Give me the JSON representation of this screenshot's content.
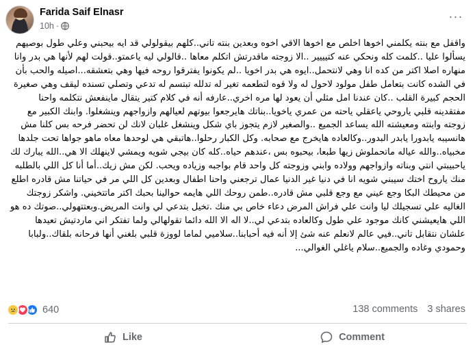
{
  "post": {
    "author": "Farida Saif Elnasr",
    "time": "10h",
    "separator": "·",
    "privacy_icon": "globe-icon",
    "more_label": "···",
    "text": "واقفل مع بنته يكلمني اخوها اخلص مع اخوها الاقي اخوه وبعدين بنته تاني..كلهم بيقولولي قد ايه بيحبني وعلي طول بوصيهم يسألوا عليا ..كلمت كله ونحكي عنه كتيييير ..الا زوجته ماقدرتش اتكلم معاها ..قالولي ليه ياعمتو..قولت لهم لأنها هي بدر وانا منهاره اصلا اكتر من كده انا وهي لانتحمل..ايوه هي بدر اخويا ..لم يكونوا يفترقوا روحه فيها وهي بتعشقه...اصيله والحب بأن في الشده كانت بتعامل طفل مولود لاحول له ولا قوه لتطعمه تغير له تدلله تبتسم له تدعي وتصلي تسنده ليقف وهي صغيرة الحجم كبيرة القلب ..كان عندنا امل مثلي أن يعود لها مره اخري..عارفه أنه في كلام كتير يتقال ماينفعش نتكلمه واحنا مفتقدينه قلبي ياروحي ياعقلي ياحته من عمري ياخويا..بناتك هايرجعوا بيوتهم لعيالهم وازواجهم وينشغلوا. وابنك الكبير مع زوجته وابنته ومعيشته الله يساعد الجميع ..والصغير لازم يتجوز باي شكل وينشغل غلبان لانك لن تحضر فرحه بس كلنا مش هانسيبه يابدورا يابدر البدور..وكالعاده هايخرج مع صحابه. وكل الكبار رحلوا..هاتبقي هي لوحدها معاه ماهو جواها تحت جلدها مخبياه..والله عياله ماتحملوش زيها طبعا، بيحبوه بس ،عندهم حياه..كله كان بيجي شويه ويمشي لاينهلك الا هي..الله يبارك لك ياحبيبتي انتي وبناته وازواجهم وولاده وابني وزوجته كل واحد قام بواجبه وزياده ويحب. لكن مش زيك..أما أنا كل اللي بالطلبه منك ياروح اختك سيبني شويه انا في دنيا غير الدنيا عمال ترجعني واحنا اطفال وبعدين كل اللي مر في حياتنا مش قادره اطلع من محيطك البكا وجع عيني مع وجع قلبي مش قادره..طمن روحك اللي هايمه حوالينا بحبك اكتر ماتتخيني. واشكر زوجتك الغاليه علي تسجيلك ليا وانت علي فراش المرض دعاء خاص بي منك .تخيل بتدعي لي وانت المريض.وبعتتهولي..صوتك ده هو اللي هايعيشني كانك موجود علي طول وكالعاده بتدعي لي..لا اله الا الله دائما تقولهالي ولما تفتكر اني ماردتيش تعيدها علشان نتقابل تاني..فيي عالم لانعلم عنه شئ إلا أنه فيه أحبابنا..سلاميي لماما لووزة قلبي بلغني أنها فرحانه بلقاك..ولبابا وحمودي وغاده والجميع..سلام ياغلي الغوالي...",
    "reactions": {
      "icons": [
        "sad-reaction-icon",
        "love-reaction-icon",
        "like-reaction-icon"
      ],
      "count": "640"
    },
    "comments": "138 comments",
    "shares": "3 shares",
    "actions": {
      "like": "Like",
      "comment": "Comment"
    },
    "colors": {
      "like_blue": "#1877f2",
      "love_red": "#f33e58",
      "sad_yellow": "#f7c843",
      "meta_gray": "#65676b"
    }
  }
}
